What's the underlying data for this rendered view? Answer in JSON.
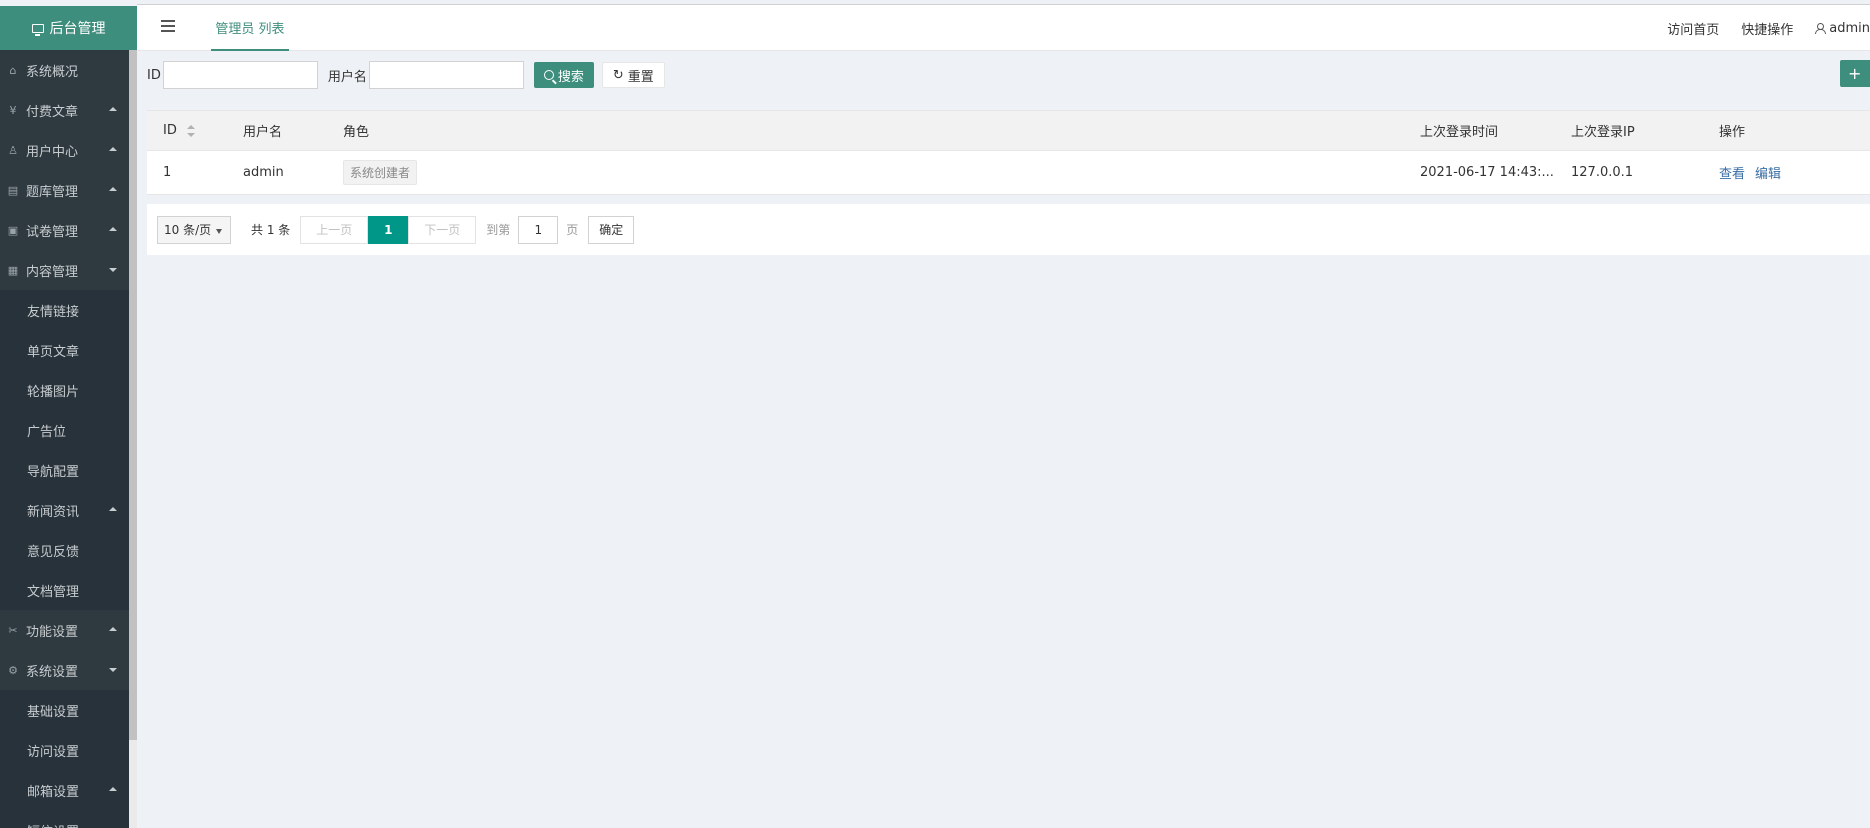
{
  "sidebar": {
    "logo": "后台管理",
    "items": [
      {
        "label": "系统概况",
        "icon": "home-icon",
        "glyph": "⌂",
        "arrow": ""
      },
      {
        "label": "付费文章",
        "icon": "yen-icon",
        "glyph": "¥",
        "arrow": "up"
      },
      {
        "label": "用户中心",
        "icon": "user-icon",
        "glyph": "♙",
        "arrow": "up"
      },
      {
        "label": "题库管理",
        "icon": "file-icon",
        "glyph": "▤",
        "arrow": "up"
      },
      {
        "label": "试卷管理",
        "icon": "paper-icon",
        "glyph": "▣",
        "arrow": "up"
      },
      {
        "label": "内容管理",
        "icon": "grid-icon",
        "glyph": "▦",
        "arrow": "down"
      }
    ],
    "content_sub": [
      "友情链接",
      "单页文章",
      "轮播图片",
      "广告位",
      "导航配置",
      "新闻资讯",
      "意见反馈",
      "文档管理"
    ],
    "items2": [
      {
        "label": "功能设置",
        "icon": "tools-icon",
        "glyph": "✂",
        "arrow": "up"
      },
      {
        "label": "系统设置",
        "icon": "gear-icon",
        "glyph": "⚙",
        "arrow": "down"
      }
    ],
    "system_sub": [
      "基础设置",
      "访问设置",
      "邮箱设置",
      "短信设置"
    ]
  },
  "header": {
    "tab": "管理员 列表",
    "links": [
      "访问首页",
      "快捷操作"
    ],
    "user": "admin"
  },
  "search": {
    "id_label": "ID",
    "username_label": "用户名",
    "search_btn": "搜索",
    "reset_btn": "重置",
    "add_btn": "+"
  },
  "table": {
    "columns": [
      "ID",
      "用户名",
      "角色",
      "上次登录时间",
      "上次登录IP",
      "操作"
    ],
    "rows": [
      {
        "id": "1",
        "username": "admin",
        "role": "系统创建者",
        "last_time": "2021-06-17 14:43:...",
        "last_ip": "127.0.0.1",
        "ops": [
          "查看",
          "编辑"
        ]
      }
    ]
  },
  "pager": {
    "page_size": "10 条/页",
    "total": "共 1 条",
    "prev": "上一页",
    "current": "1",
    "next": "下一页",
    "goto": "到第",
    "goto_value": "1",
    "page_unit": "页",
    "confirm": "确定"
  }
}
